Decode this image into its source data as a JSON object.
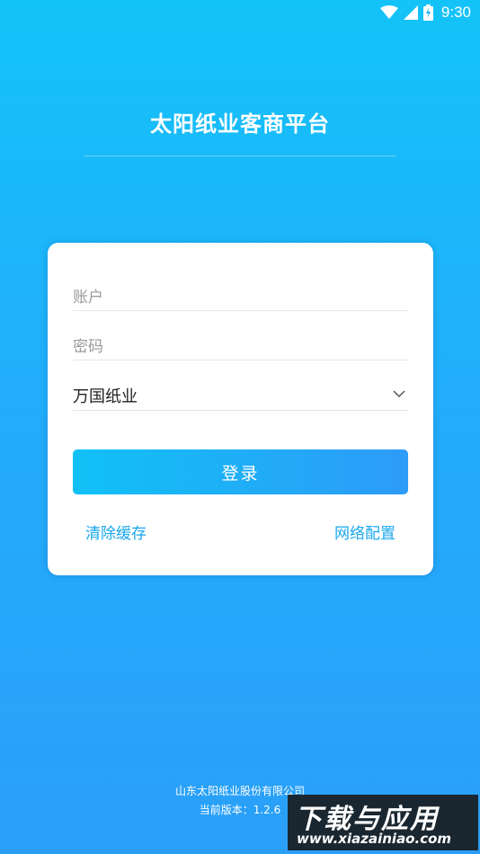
{
  "status_bar": {
    "time": "9:30",
    "icons": [
      "wifi-icon",
      "signal-icon",
      "battery-charging-icon"
    ]
  },
  "app": {
    "title": "太阳纸业客商平台"
  },
  "login_form": {
    "account_placeholder": "账户",
    "account_value": "",
    "password_placeholder": "密码",
    "password_value": "",
    "company_selected": "万国纸业",
    "login_label": "登录",
    "clear_cache_label": "清除缓存",
    "network_config_label": "网络配置"
  },
  "footer": {
    "company": "山东太阳纸业股份有限公司",
    "version": "当前版本：1.2.6"
  },
  "watermark": {
    "main_text": "下载与应用",
    "url": "www.xiazainiao.com"
  },
  "colors": {
    "background_top": "#13c3f8",
    "background_bottom": "#2a9ff8",
    "accent": "#1aa8ee",
    "button_start": "#11c1f6",
    "button_end": "#2d9bf8"
  }
}
